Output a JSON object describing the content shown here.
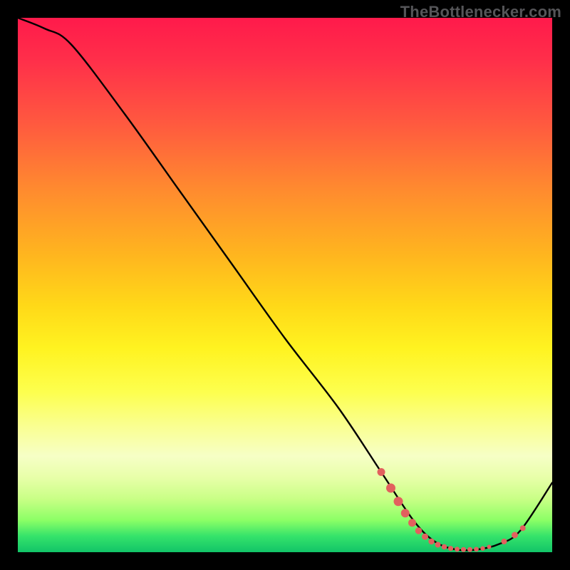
{
  "attribution": "TheBottlenecker.com",
  "chart_data": {
    "type": "line",
    "title": "",
    "xlabel": "",
    "ylabel": "",
    "xlim": [
      0,
      100
    ],
    "ylim": [
      0,
      100
    ],
    "series": [
      {
        "name": "bottleneck-curve",
        "x": [
          0,
          5,
          10,
          20,
          30,
          40,
          50,
          60,
          68,
          74,
          78,
          82,
          86,
          90,
          94,
          100
        ],
        "y": [
          100,
          98,
          95,
          82,
          68,
          54,
          40,
          27,
          15,
          6,
          2,
          0.5,
          0.5,
          1.5,
          4,
          13
        ]
      }
    ],
    "markers": [
      {
        "name": "marker-cluster",
        "x": 68.0,
        "y": 15.0,
        "r": 5.5
      },
      {
        "name": "marker-cluster",
        "x": 69.8,
        "y": 12.0,
        "r": 6.5
      },
      {
        "name": "marker-cluster",
        "x": 71.2,
        "y": 9.5,
        "r": 6.5
      },
      {
        "name": "marker-cluster",
        "x": 72.5,
        "y": 7.3,
        "r": 6.0
      },
      {
        "name": "marker-cluster",
        "x": 73.8,
        "y": 5.5,
        "r": 5.5
      },
      {
        "name": "marker-cluster",
        "x": 75.0,
        "y": 4.0,
        "r": 4.8
      },
      {
        "name": "marker-cluster",
        "x": 76.2,
        "y": 2.9,
        "r": 4.5
      },
      {
        "name": "marker-cluster",
        "x": 77.4,
        "y": 2.0,
        "r": 4.2
      },
      {
        "name": "marker-cluster",
        "x": 78.6,
        "y": 1.4,
        "r": 4.0
      },
      {
        "name": "marker-cluster",
        "x": 79.8,
        "y": 1.0,
        "r": 3.8
      },
      {
        "name": "marker-cluster",
        "x": 81.0,
        "y": 0.7,
        "r": 3.6
      },
      {
        "name": "marker-cluster",
        "x": 82.2,
        "y": 0.55,
        "r": 3.5
      },
      {
        "name": "marker-cluster",
        "x": 83.4,
        "y": 0.5,
        "r": 3.5
      },
      {
        "name": "marker-cluster",
        "x": 84.6,
        "y": 0.5,
        "r": 3.5
      },
      {
        "name": "marker-cluster",
        "x": 85.8,
        "y": 0.55,
        "r": 3.4
      },
      {
        "name": "marker-cluster",
        "x": 87.0,
        "y": 0.7,
        "r": 3.2
      },
      {
        "name": "marker-cluster",
        "x": 88.2,
        "y": 1.0,
        "r": 3.0
      },
      {
        "name": "marker-cluster",
        "x": 91.0,
        "y": 2.0,
        "r": 4.0
      },
      {
        "name": "marker-cluster",
        "x": 93.0,
        "y": 3.2,
        "r": 4.5
      },
      {
        "name": "marker-cluster",
        "x": 94.5,
        "y": 4.5,
        "r": 4.0
      }
    ],
    "colors": {
      "curve": "#000000",
      "marker_fill": "#e2605e",
      "marker_stroke": "#e2605e"
    }
  }
}
